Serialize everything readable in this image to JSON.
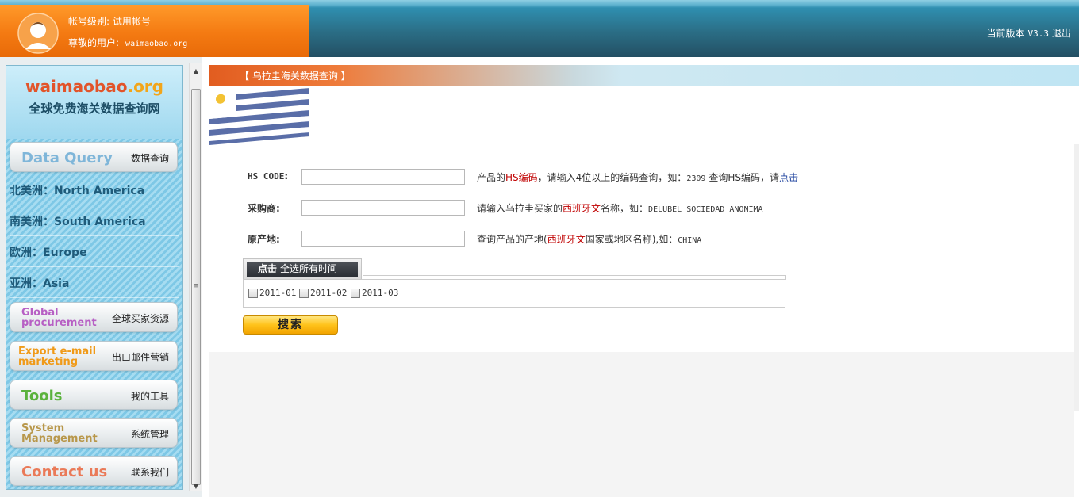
{
  "header": {
    "account_level": "帐号级别: 试用帐号",
    "user_prefix": "尊敬的用户:",
    "user_name": "waimaobao.org",
    "version_label": "当前版本",
    "version": "V3.3",
    "logout": "退出"
  },
  "sidebar": {
    "logo_domain": "waimaobao",
    "logo_tld": ".org",
    "logo_subtitle": "全球免费海关数据查询网",
    "data_query": {
      "en": "Data Query",
      "zh": "数据查询",
      "color": "#7fb6d9"
    },
    "regions": [
      "北美洲：North America",
      "南美洲：South America",
      "欧洲：Europe",
      "亚洲：Asia"
    ],
    "global_procurement": {
      "en1": "Global",
      "en2": "procurement",
      "zh": "全球买家资源",
      "color": "#b75fc4"
    },
    "export_marketing": {
      "en1": "Export e-mail",
      "en2": "marketing",
      "zh": "出口邮件营销",
      "color": "#f09a18"
    },
    "tools": {
      "en": "Tools",
      "zh": "我的工具",
      "color": "#5ab23c"
    },
    "system_management": {
      "en1": "System",
      "en2": "Management",
      "zh": "系统管理",
      "color": "#b8974a"
    },
    "contact": {
      "en": "Contact us",
      "zh": "联系我们",
      "color": "#ea7a58"
    }
  },
  "main": {
    "title": "【  乌拉圭海关数据查询  】",
    "hs_code": {
      "label": "HS CODE",
      "suffix": ":",
      "value": "",
      "hint_pre": "产品的",
      "hint_red": "HS编码",
      "hint_mid": "，请输入4位以上的编码查询，如：",
      "hint_example": "2309",
      "hint_post": "查询HS编码，请",
      "hint_link": "点击"
    },
    "buyer": {
      "label": "采购商",
      "suffix": ":",
      "value": "",
      "hint_pre": "请输入乌拉圭买家的",
      "hint_red": "西班牙文",
      "hint_mid": "名称，如：",
      "hint_example": "DELUBEL SOCIEDAD ANONIMA"
    },
    "origin": {
      "label": "原产地",
      "suffix": ":",
      "value": "",
      "hint_pre": "查询产品的产地(",
      "hint_red": "西班牙文",
      "hint_mid": "国家或地区名称),如：",
      "hint_example": "CHINA"
    },
    "time_tab_bold": "点击",
    "time_tab_text": "全选所有时间",
    "periods": [
      "2011-01",
      "2011-02",
      "2011-03"
    ],
    "search_button": "搜索"
  }
}
